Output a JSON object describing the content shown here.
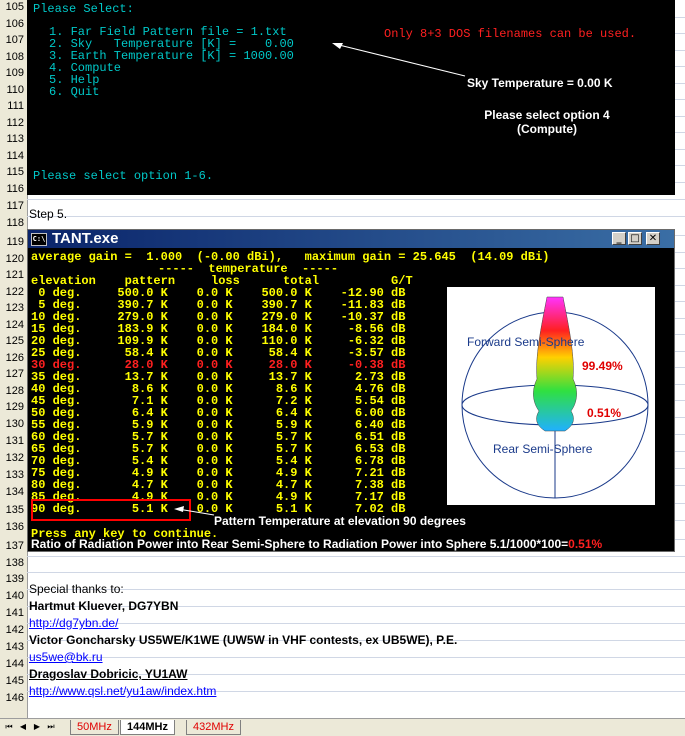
{
  "rows": [
    "105",
    "106",
    "107",
    "108",
    "109",
    "110",
    "111",
    "112",
    "113",
    "114",
    "115",
    "116",
    "117",
    "118",
    "119",
    "120",
    "121",
    "122",
    "123",
    "124",
    "125",
    "126",
    "127",
    "128",
    "129",
    "130",
    "131",
    "132",
    "133",
    "134",
    "135",
    "136",
    "137",
    "138",
    "139",
    "140",
    "141",
    "142",
    "143",
    "144",
    "145",
    "146"
  ],
  "dos_menu": {
    "prompt": "Please Select:",
    "items": [
      "1. Far Field Pattern file = 1.txt",
      "2. Sky   Temperature [K] =    0.00",
      "3. Earth Temperature [K] = 1000.00",
      "4. Compute",
      "5. Help",
      "6. Quit"
    ],
    "warning": "Only 8+3 DOS filenames can be used.",
    "footer": "Please select option 1-6.",
    "callout_sky": "Sky Temperature = 0.00 K",
    "callout_select_1": "Please select option 4",
    "callout_select_2": "(Compute)"
  },
  "step5": "Step 5.",
  "tant": {
    "title": "TANT.exe",
    "icon": "C:\\",
    "gain_line": "average gain =  1.000  (-0.00 dBi),   maximum gain = 25.645  (14.09 dBi)",
    "temp_header": "-----  temperature  -----",
    "col_header": "elevation    pattern     loss      total          G/T",
    "rows": [
      " 0 deg.     500.0 K    0.0 K    500.0 K    -12.90 dB",
      " 5 deg.     390.7 K    0.0 K    390.7 K    -11.83 dB",
      "10 deg.     279.0 K    0.0 K    279.0 K    -10.37 dB",
      "15 deg.     183.9 K    0.0 K    184.0 K     -8.56 dB",
      "20 deg.     109.9 K    0.0 K    110.0 K     -6.32 dB",
      "25 deg.      58.4 K    0.0 K     58.4 K     -3.57 dB",
      "30 deg.      28.0 K    0.0 K     28.0 K     -0.38 dB",
      "35 deg.      13.7 K    0.0 K     13.7 K      2.73 dB",
      "40 deg.       8.6 K    0.0 K      8.6 K      4.76 dB",
      "45 deg.       7.1 K    0.0 K      7.2 K      5.54 dB",
      "50 deg.       6.4 K    0.0 K      6.4 K      6.00 dB",
      "55 deg.       5.9 K    0.0 K      5.9 K      6.40 dB",
      "60 deg.       5.7 K    0.0 K      5.7 K      6.51 dB",
      "65 deg.       5.7 K    0.0 K      5.7 K      6.53 dB",
      "70 deg.       5.4 K    0.0 K      5.4 K      6.78 dB",
      "75 deg.       4.9 K    0.0 K      4.9 K      7.21 dB",
      "80 deg.       4.7 K    0.0 K      4.7 K      7.38 dB",
      "85 deg.       4.9 K    0.0 K      4.9 K      7.17 dB",
      "90 deg.       5.1 K    0.0 K      5.1 K      7.02 dB"
    ],
    "elev_label": "elevation",
    "highlight_row_index": 6,
    "press_key": "Press any key to continue.",
    "callout_pattern": "Pattern Temperature at elevation 90 degrees",
    "ratio_text": "Ratio of Radiation Power into Rear Semi-Sphere to Radiation Power into Sphere 5.1/1000*100=",
    "ratio_value": "0.51%",
    "sphere": {
      "forward": "Forward Semi-Sphere",
      "rear": "Rear Semi-Sphere",
      "forward_pct": "99.49%",
      "rear_pct": "0.51%"
    }
  },
  "credits": {
    "thanks": "Special thanks to:",
    "name1": "Hartmut Kluever, DG7YBN",
    "link1": "http://dg7ybn.de/",
    "name2": "Victor Goncharsky US5WE/K1WE (UW5W in VHF contests, ex UB5WE), P.E.",
    "link2": "us5we@bk.ru",
    "name3": "Dragoslav Dobricic, YU1AW",
    "link3": "http://www.qsl.net/yu1aw/index.htm"
  },
  "sheet_tabs": [
    "50MHz",
    "144MHz",
    "432MHz"
  ],
  "active_tab": "144MHz",
  "colors": {
    "dos_cyan": "#00c8c8",
    "dos_yellow": "#ffff00",
    "dos_red": "#ff2020",
    "title_blue": "#0a246a"
  }
}
